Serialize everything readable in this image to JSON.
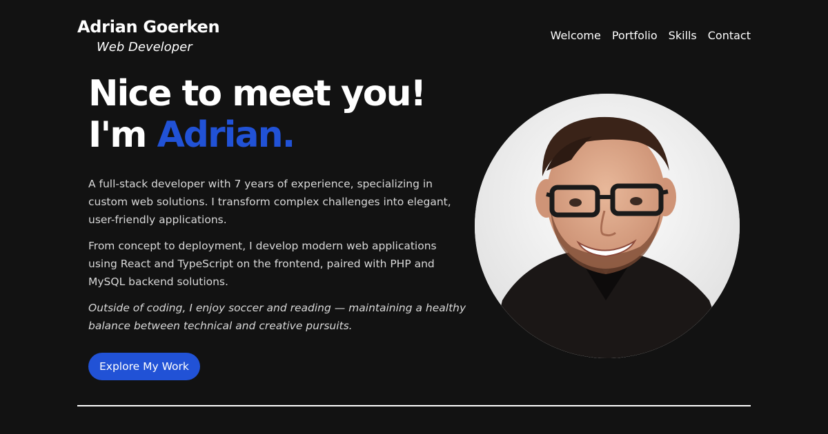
{
  "header": {
    "name": "Adrian Goerken",
    "role": "Web Developer"
  },
  "nav": {
    "items": [
      {
        "label": "Welcome"
      },
      {
        "label": "Portfolio"
      },
      {
        "label": "Skills"
      },
      {
        "label": "Contact"
      }
    ]
  },
  "hero": {
    "headline_line1": "Nice to meet you!",
    "headline_prefix": "I'm ",
    "headline_name": "Adrian.",
    "paragraph1": "A full-stack developer with 7 years of experience, specializing in custom web solutions. I transform complex challenges into elegant, user-friendly applications.",
    "paragraph2": "From concept to deployment, I develop modern web applications using React and TypeScript on the frontend, paired with PHP and MySQL backend solutions.",
    "paragraph3": "Outside of coding, I enjoy soccer and reading — maintaining a healthy balance between technical and creative pursuits.",
    "cta_label": "Explore My Work"
  },
  "portrait": {
    "icon": "person-photo"
  },
  "colors": {
    "background": "#121212",
    "accent": "#2152d6",
    "text": "#ffffff",
    "body_text": "#d8d8d8"
  }
}
